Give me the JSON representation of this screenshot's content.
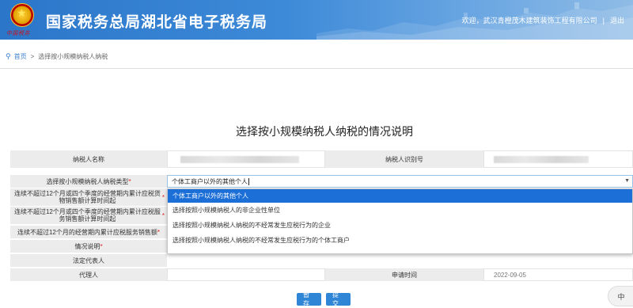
{
  "header": {
    "title": "国家税务总局湖北省电子税务局",
    "welcome": "欢迎，武汉青橙茂木建筑装饰工程有限公司",
    "separator": "|",
    "logout": "退出",
    "brand_script": "中国税务"
  },
  "breadcrumb": {
    "home": "首页",
    "arrow": ">",
    "current": "选择按小规模纳税人纳税"
  },
  "page_title": "选择按小规模纳税人纳税的情况说明",
  "form": {
    "taxpayer_name_label": "纳税人名称",
    "taxpayer_id_label": "纳税人识别号",
    "type_label": "选择按小规模纳税人纳税类型",
    "type_value": "个体工商户以外的其他个人",
    "goods_start_label": "连续不超过12个月或四个季度的经营期内累计应税货物销售额计算时间起",
    "service_start_label": "连续不超过12个月或四个季度的经营期内累计应税服务销售额计算时间起",
    "service_sales_label": "连续不超过12个月的经营期内累计应税服务销售额",
    "explain_label": "情况说明",
    "legal_rep_label": "法定代表人",
    "agent_label": "代理人",
    "apply_date_label": "申请时间",
    "apply_date_value": "2022-09-05",
    "required_mark": "*"
  },
  "dropdown": {
    "options": [
      "个体工商户以外的其他个人",
      "选择按照小规模纳税人的非企业性单位",
      "选择按照小规模纳税人纳税的不经常发生应税行为的企业",
      "选择按照小规模纳税人纳税的不经常发生应税行为的个体工商户"
    ],
    "selected_index": 0
  },
  "buttons": {
    "save": "暂存",
    "submit": "提交"
  },
  "floating_badge": "中",
  "colors": {
    "header_blue": "#2c76c9",
    "link_blue": "#3b7fcf",
    "selected_blue": "#1d6fd8",
    "button_blue": "#2f86d6",
    "required_red": "#e02020",
    "label_gray": "#ececec"
  },
  "icons": {
    "breadcrumb": "location-pin-icon",
    "select_caret": "caret-down-icon"
  }
}
